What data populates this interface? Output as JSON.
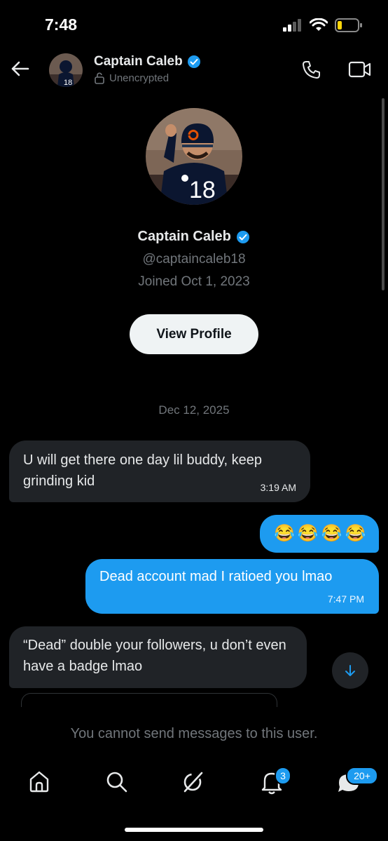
{
  "status_bar": {
    "time": "7:48"
  },
  "header": {
    "name": "Captain Caleb",
    "subtitle": "Unencrypted",
    "icons": [
      "back-arrow-icon",
      "lock-open-icon",
      "verified-icon",
      "phone-icon",
      "video-icon"
    ]
  },
  "profile": {
    "name": "Captain Caleb",
    "handle": "@captaincaleb18",
    "joined": "Joined Oct 1, 2023",
    "view_profile_label": "View Profile",
    "jersey_number": "18"
  },
  "conversation": {
    "date_separator": "Dec 12, 2025",
    "messages": [
      {
        "direction": "in",
        "text": "U will get there one day lil buddy, keep grinding kid",
        "time": "3:19 AM"
      },
      {
        "direction": "out",
        "text": "😂😂😂😂",
        "time": ""
      },
      {
        "direction": "out",
        "text": "Dead account mad I ratioed you lmao",
        "time": "7:47 PM"
      },
      {
        "direction": "in",
        "text": "“Dead” double your followers, u don’t even have a badge lmao",
        "time": ""
      }
    ]
  },
  "composer_notice": "You cannot send messages to this user.",
  "bottom_nav": {
    "items": [
      "home-icon",
      "search-icon",
      "grok-icon",
      "notifications-icon",
      "messages-icon"
    ],
    "notifications_badge": "3",
    "messages_badge": "20+"
  },
  "colors": {
    "accent": "#1d9bf0",
    "background": "#000000",
    "incoming_bubble": "#202327",
    "muted_text": "#71767b"
  }
}
